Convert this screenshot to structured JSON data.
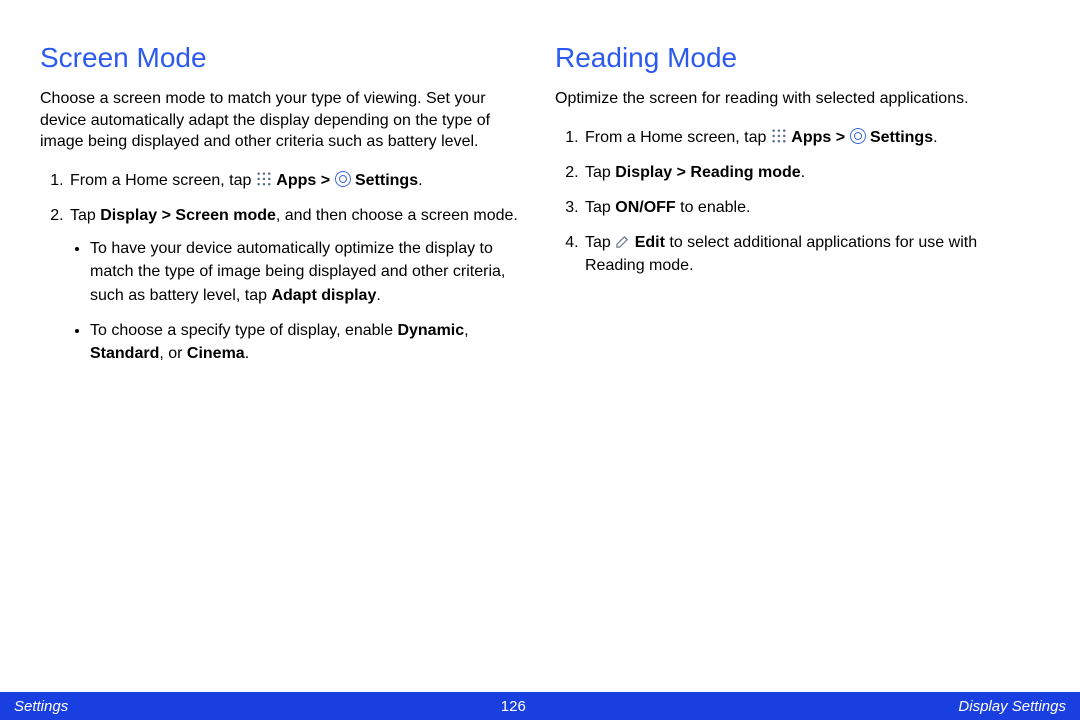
{
  "left": {
    "title": "Screen Mode",
    "intro": "Choose a screen mode to match your type of viewing. Set your device automatically adapt the display depending on the type of image being displayed and other criteria such as battery level.",
    "step1_pre": "From a Home screen, tap ",
    "apps_label": "Apps",
    "gt": " > ",
    "settings_label": "Settings",
    "period": ".",
    "step2_pre": "Tap ",
    "step2_bold": "Display > Screen mode",
    "step2_post": ", and then choose a screen mode.",
    "bullet1_pre": "To have your device automatically optimize the display to match the type of image being displayed and other criteria, such as battery level, tap ",
    "bullet1_bold": "Adapt display",
    "bullet2_pre": "To choose a specify type of display, enable ",
    "bullet2_bold1": "Dynamic",
    "bullet2_sep1": ", ",
    "bullet2_bold2": "Standard",
    "bullet2_sep2": ", or ",
    "bullet2_bold3": "Cinema"
  },
  "right": {
    "title": "Reading Mode",
    "intro": "Optimize the screen for reading with selected applications.",
    "step1_pre": "From a Home screen, tap ",
    "apps_label": "Apps",
    "gt": " > ",
    "settings_label": "Settings",
    "period": ".",
    "step2_pre": "Tap ",
    "step2_bold": "Display > Reading mode",
    "step3_pre": "Tap ",
    "step3_bold": "ON/OFF",
    "step3_post": " to enable.",
    "step4_pre": "Tap ",
    "step4_bold": "Edit",
    "step4_post": " to select additional applications for use with Reading mode."
  },
  "footer": {
    "left": "Settings",
    "center": "126",
    "right": "Display Settings"
  }
}
